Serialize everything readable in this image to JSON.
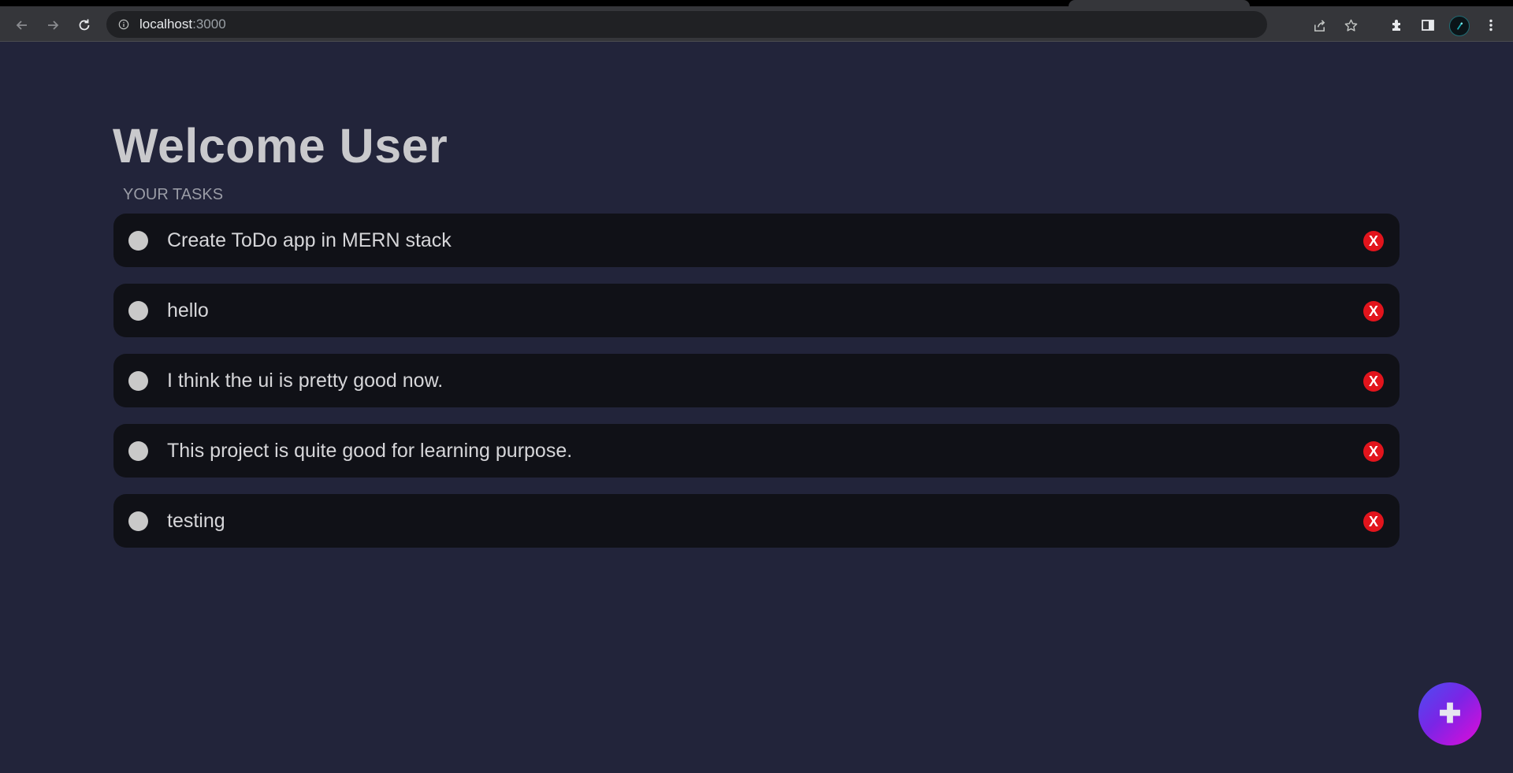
{
  "browser": {
    "url_host": "localhost",
    "url_port": ":3000",
    "icons": {
      "back": "arrow-left-icon",
      "forward": "arrow-right-icon",
      "reload": "reload-icon",
      "site_info": "info-icon",
      "share": "share-icon",
      "bookmark": "star-icon",
      "extensions": "puzzle-icon",
      "side_panel": "side-panel-icon",
      "menu": "kebab-menu-icon"
    }
  },
  "page": {
    "title": "Welcome User",
    "section_label": "YOUR TASKS",
    "tasks": [
      {
        "text": "Create ToDo app in MERN stack",
        "delete_label": "X"
      },
      {
        "text": "hello",
        "delete_label": "X"
      },
      {
        "text": "I think the ui is pretty good now.",
        "delete_label": "X"
      },
      {
        "text": "This project is quite good for learning purpose.",
        "delete_label": "X"
      },
      {
        "text": "testing",
        "delete_label": "X"
      }
    ],
    "add_button_label": "✚"
  },
  "colors": {
    "background": "#22243a",
    "task_background": "#101117",
    "delete": "#e2141c",
    "fab_gradient_start": "#e10bd8",
    "fab_gradient_end": "#4b4ef0"
  }
}
